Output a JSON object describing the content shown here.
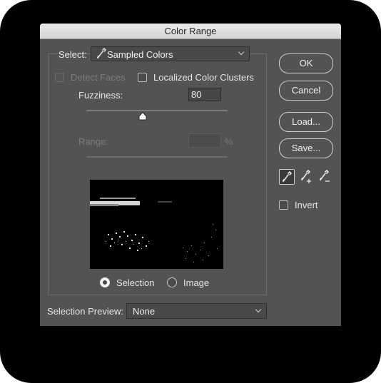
{
  "dialog": {
    "title": "Color Range"
  },
  "select": {
    "label": "Select:",
    "value": "Sampled Colors",
    "icon": "eyedropper-icon"
  },
  "options": {
    "detect_faces": {
      "label": "Detect Faces",
      "checked": false,
      "enabled": false
    },
    "localized_clusters": {
      "label": "Localized Color Clusters",
      "checked": false,
      "enabled": true
    }
  },
  "fuzziness": {
    "label": "Fuzziness:",
    "value": "80",
    "slider_fraction": 0.4
  },
  "range": {
    "label": "Range:",
    "value": "",
    "unit": "%",
    "enabled": false
  },
  "preview_mode": {
    "selection_label": "Selection",
    "image_label": "Image",
    "selected": "selection"
  },
  "selection_preview": {
    "label": "Selection Preview:",
    "value": "None"
  },
  "buttons": {
    "ok": "OK",
    "cancel": "Cancel",
    "load": "Load...",
    "save": "Save..."
  },
  "tools": [
    "eyedropper-icon",
    "eyedropper-plus-icon",
    "eyedropper-minus-icon"
  ],
  "invert": {
    "label": "Invert",
    "checked": false
  },
  "colors": {
    "dialog_bg": "#535353",
    "title_bar": "#dcdcdc"
  }
}
